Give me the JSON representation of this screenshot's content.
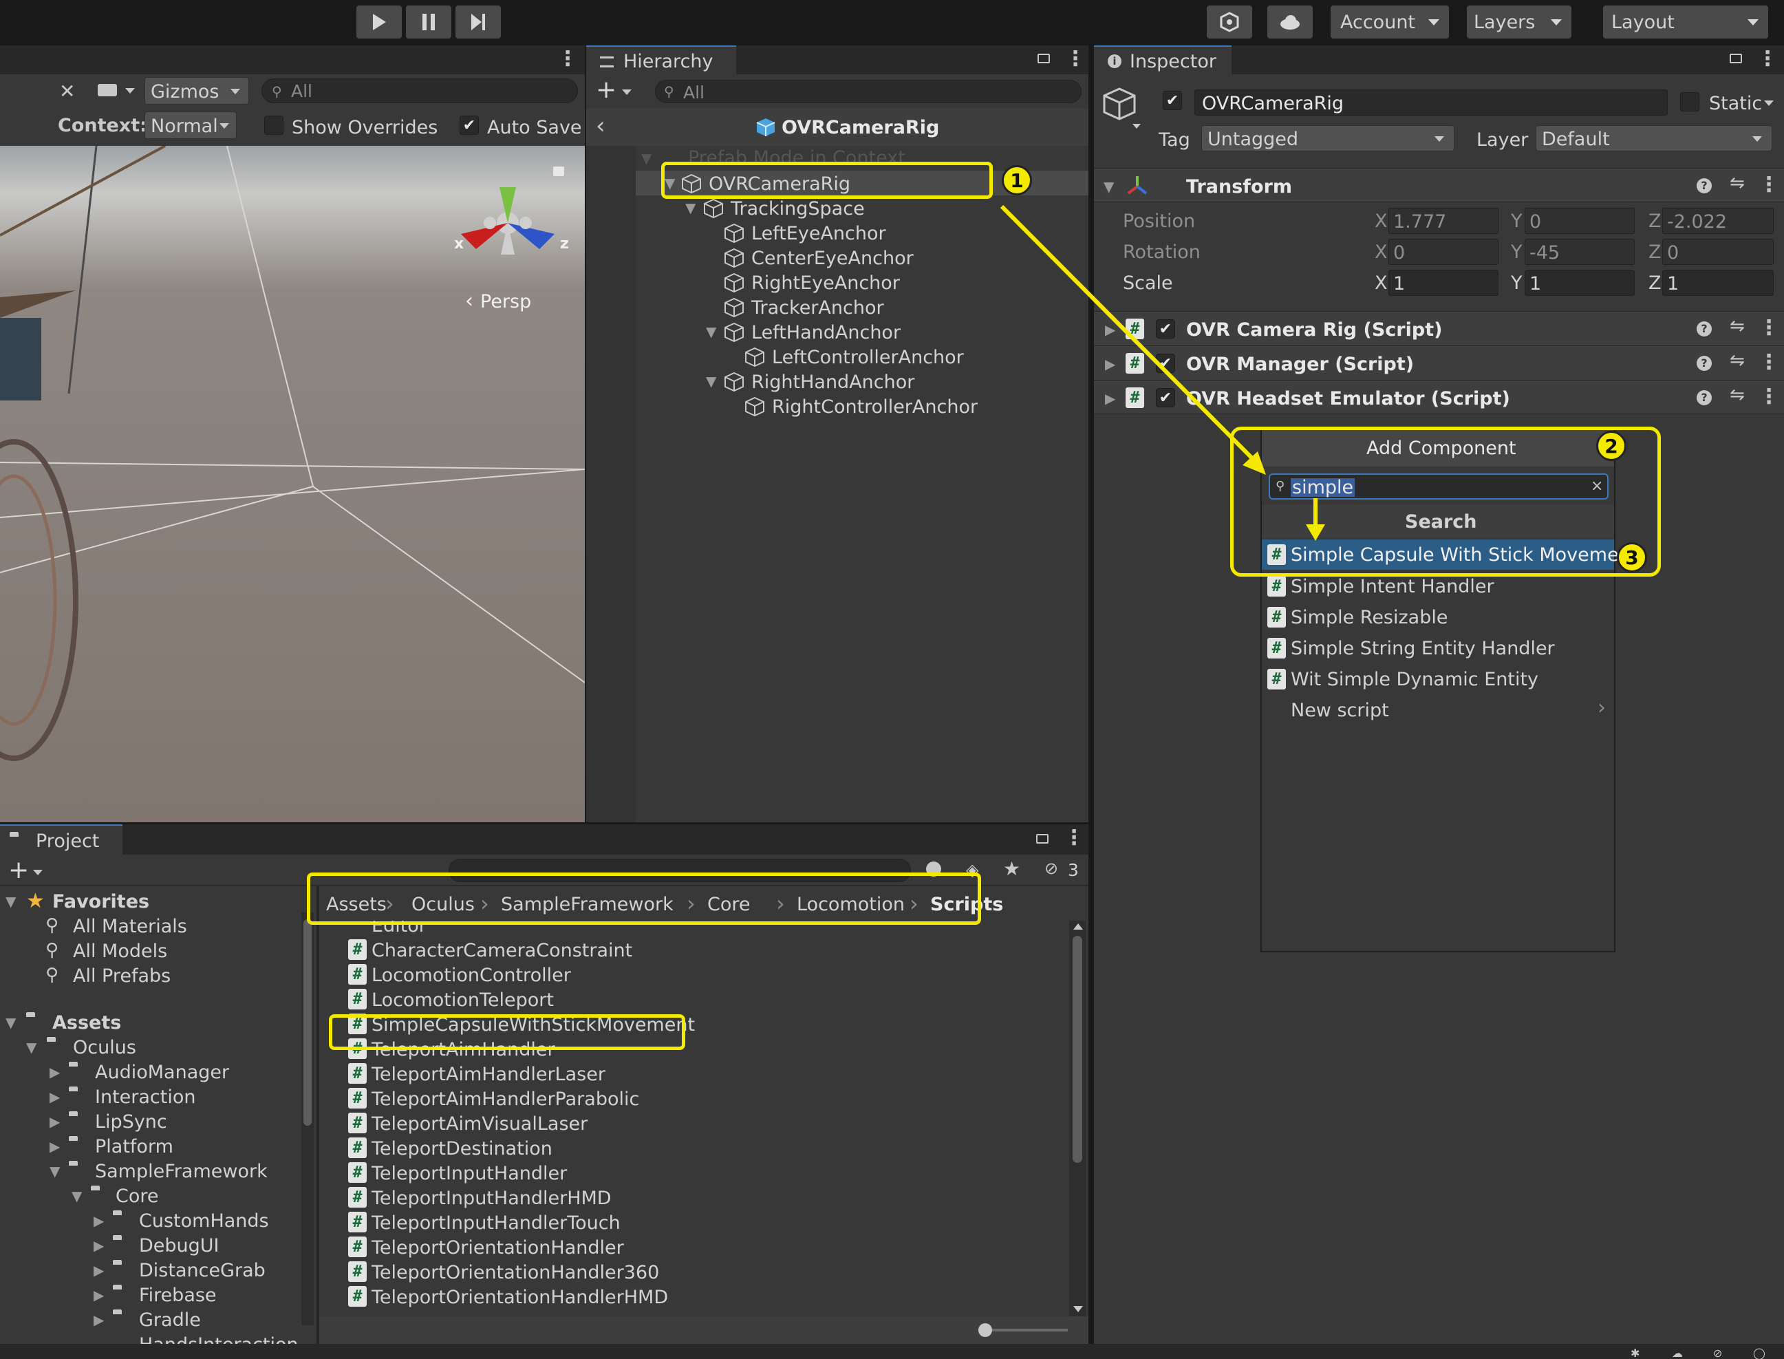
{
  "toolbar": {
    "account": "Account",
    "layers": "Layers",
    "layout": "Layout"
  },
  "scene": {
    "gizmos": "Gizmos",
    "search_placeholder": "All",
    "context_label": "Context:",
    "context_value": "Normal",
    "show_overrides": "Show Overrides",
    "auto_save": "Auto Save",
    "persp": "Persp",
    "axis_x": "x",
    "axis_z": "z"
  },
  "hierarchy": {
    "tab": "Hierarchy",
    "search_placeholder": "All",
    "prefab_title": "OVRCameraRig",
    "items": [
      "Prefab Mode in Context",
      "OVRCameraRig",
      "TrackingSpace",
      "LeftEyeAnchor",
      "CenterEyeAnchor",
      "RightEyeAnchor",
      "TrackerAnchor",
      "LeftHandAnchor",
      "LeftControllerAnchor",
      "RightHandAnchor",
      "RightControllerAnchor"
    ]
  },
  "inspector": {
    "tab": "Inspector",
    "object_name": "OVRCameraRig",
    "static": "Static",
    "tag_label": "Tag",
    "tag_value": "Untagged",
    "layer_label": "Layer",
    "layer_value": "Default",
    "transform": {
      "title": "Transform",
      "rows": [
        {
          "label": "Position",
          "x": "1.777",
          "y": "0",
          "z": "-2.022"
        },
        {
          "label": "Rotation",
          "x": "0",
          "y": "-45",
          "z": "0"
        },
        {
          "label": "Scale",
          "x": "1",
          "y": "1",
          "z": "1"
        }
      ],
      "axis_x": "X",
      "axis_y": "Y",
      "axis_z": "Z"
    },
    "components": [
      "OVR Camera Rig (Script)",
      "OVR Manager (Script)",
      "OVR Headset Emulator (Script)"
    ]
  },
  "add_component": {
    "title": "Add Component",
    "search_value": "simple",
    "section": "Search",
    "results": [
      "Simple Capsule With Stick Movemen",
      "Simple Intent Handler",
      "Simple Resizable",
      "Simple String Entity Handler",
      "Wit Simple Dynamic Entity"
    ],
    "new_script": "New script"
  },
  "project": {
    "tab": "Project",
    "hidden_count": "3",
    "favorites": {
      "title": "Favorites",
      "items": [
        "All Materials",
        "All Models",
        "All Prefabs"
      ]
    },
    "tree": {
      "assets": "Assets",
      "oculus": "Oculus",
      "children": [
        "AudioManager",
        "Interaction",
        "LipSync",
        "Platform"
      ],
      "sample_framework": "SampleFramework",
      "core": "Core",
      "core_children": [
        "CustomHands",
        "DebugUI",
        "DistanceGrab",
        "Firebase",
        "Gradle",
        "HandsInteraction"
      ]
    },
    "breadcrumb": [
      "Assets",
      "Oculus",
      "SampleFramework",
      "Core",
      "Locomotion",
      "Scripts"
    ],
    "files": [
      "Editor",
      "CharacterCameraConstraint",
      "LocomotionController",
      "LocomotionTeleport",
      "SimpleCapsuleWithStickMovement",
      "TeleportAimHandler",
      "TeleportAimHandlerLaser",
      "TeleportAimHandlerParabolic",
      "TeleportAimVisualLaser",
      "TeleportDestination",
      "TeleportInputHandler",
      "TeleportInputHandlerHMD",
      "TeleportInputHandlerTouch",
      "TeleportOrientationHandler",
      "TeleportOrientationHandler360",
      "TeleportOrientationHandlerHMD"
    ]
  },
  "annotations": [
    "1",
    "2",
    "3"
  ]
}
